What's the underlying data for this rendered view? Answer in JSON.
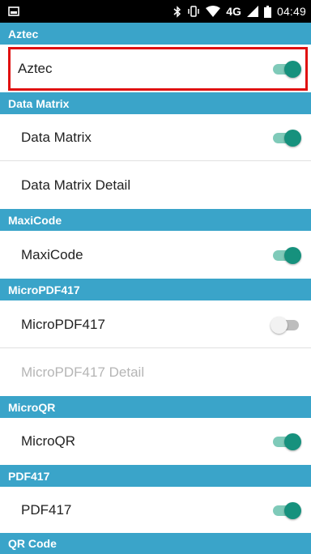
{
  "status_bar": {
    "time": "04:49",
    "network": "4G",
    "icons": [
      "screenshot-icon",
      "bluetooth-icon",
      "vibrate-icon",
      "wifi-icon",
      "signal-icon",
      "battery-icon"
    ]
  },
  "colors": {
    "header_bg": "#3aa4c9",
    "switch_on": "#16917d",
    "switch_on_track": "#7fcab9",
    "highlight": "#e01010"
  },
  "sections": [
    {
      "header": "Aztec",
      "rows": [
        {
          "label": "Aztec",
          "toggle": "on"
        }
      ]
    },
    {
      "header": "Data Matrix",
      "rows": [
        {
          "label": "Data Matrix",
          "toggle": "on"
        },
        {
          "label": "Data Matrix Detail"
        }
      ]
    },
    {
      "header": "MaxiCode",
      "rows": [
        {
          "label": "MaxiCode",
          "toggle": "on"
        }
      ]
    },
    {
      "header": "MicroPDF417",
      "rows": [
        {
          "label": "MicroPDF417",
          "toggle": "off"
        },
        {
          "label": "MicroPDF417 Detail",
          "disabled": true
        }
      ]
    },
    {
      "header": "MicroQR",
      "rows": [
        {
          "label": "MicroQR",
          "toggle": "on"
        }
      ]
    },
    {
      "header": "PDF417",
      "rows": [
        {
          "label": "PDF417",
          "toggle": "on"
        }
      ]
    },
    {
      "header": "QR Code",
      "rows": []
    }
  ]
}
